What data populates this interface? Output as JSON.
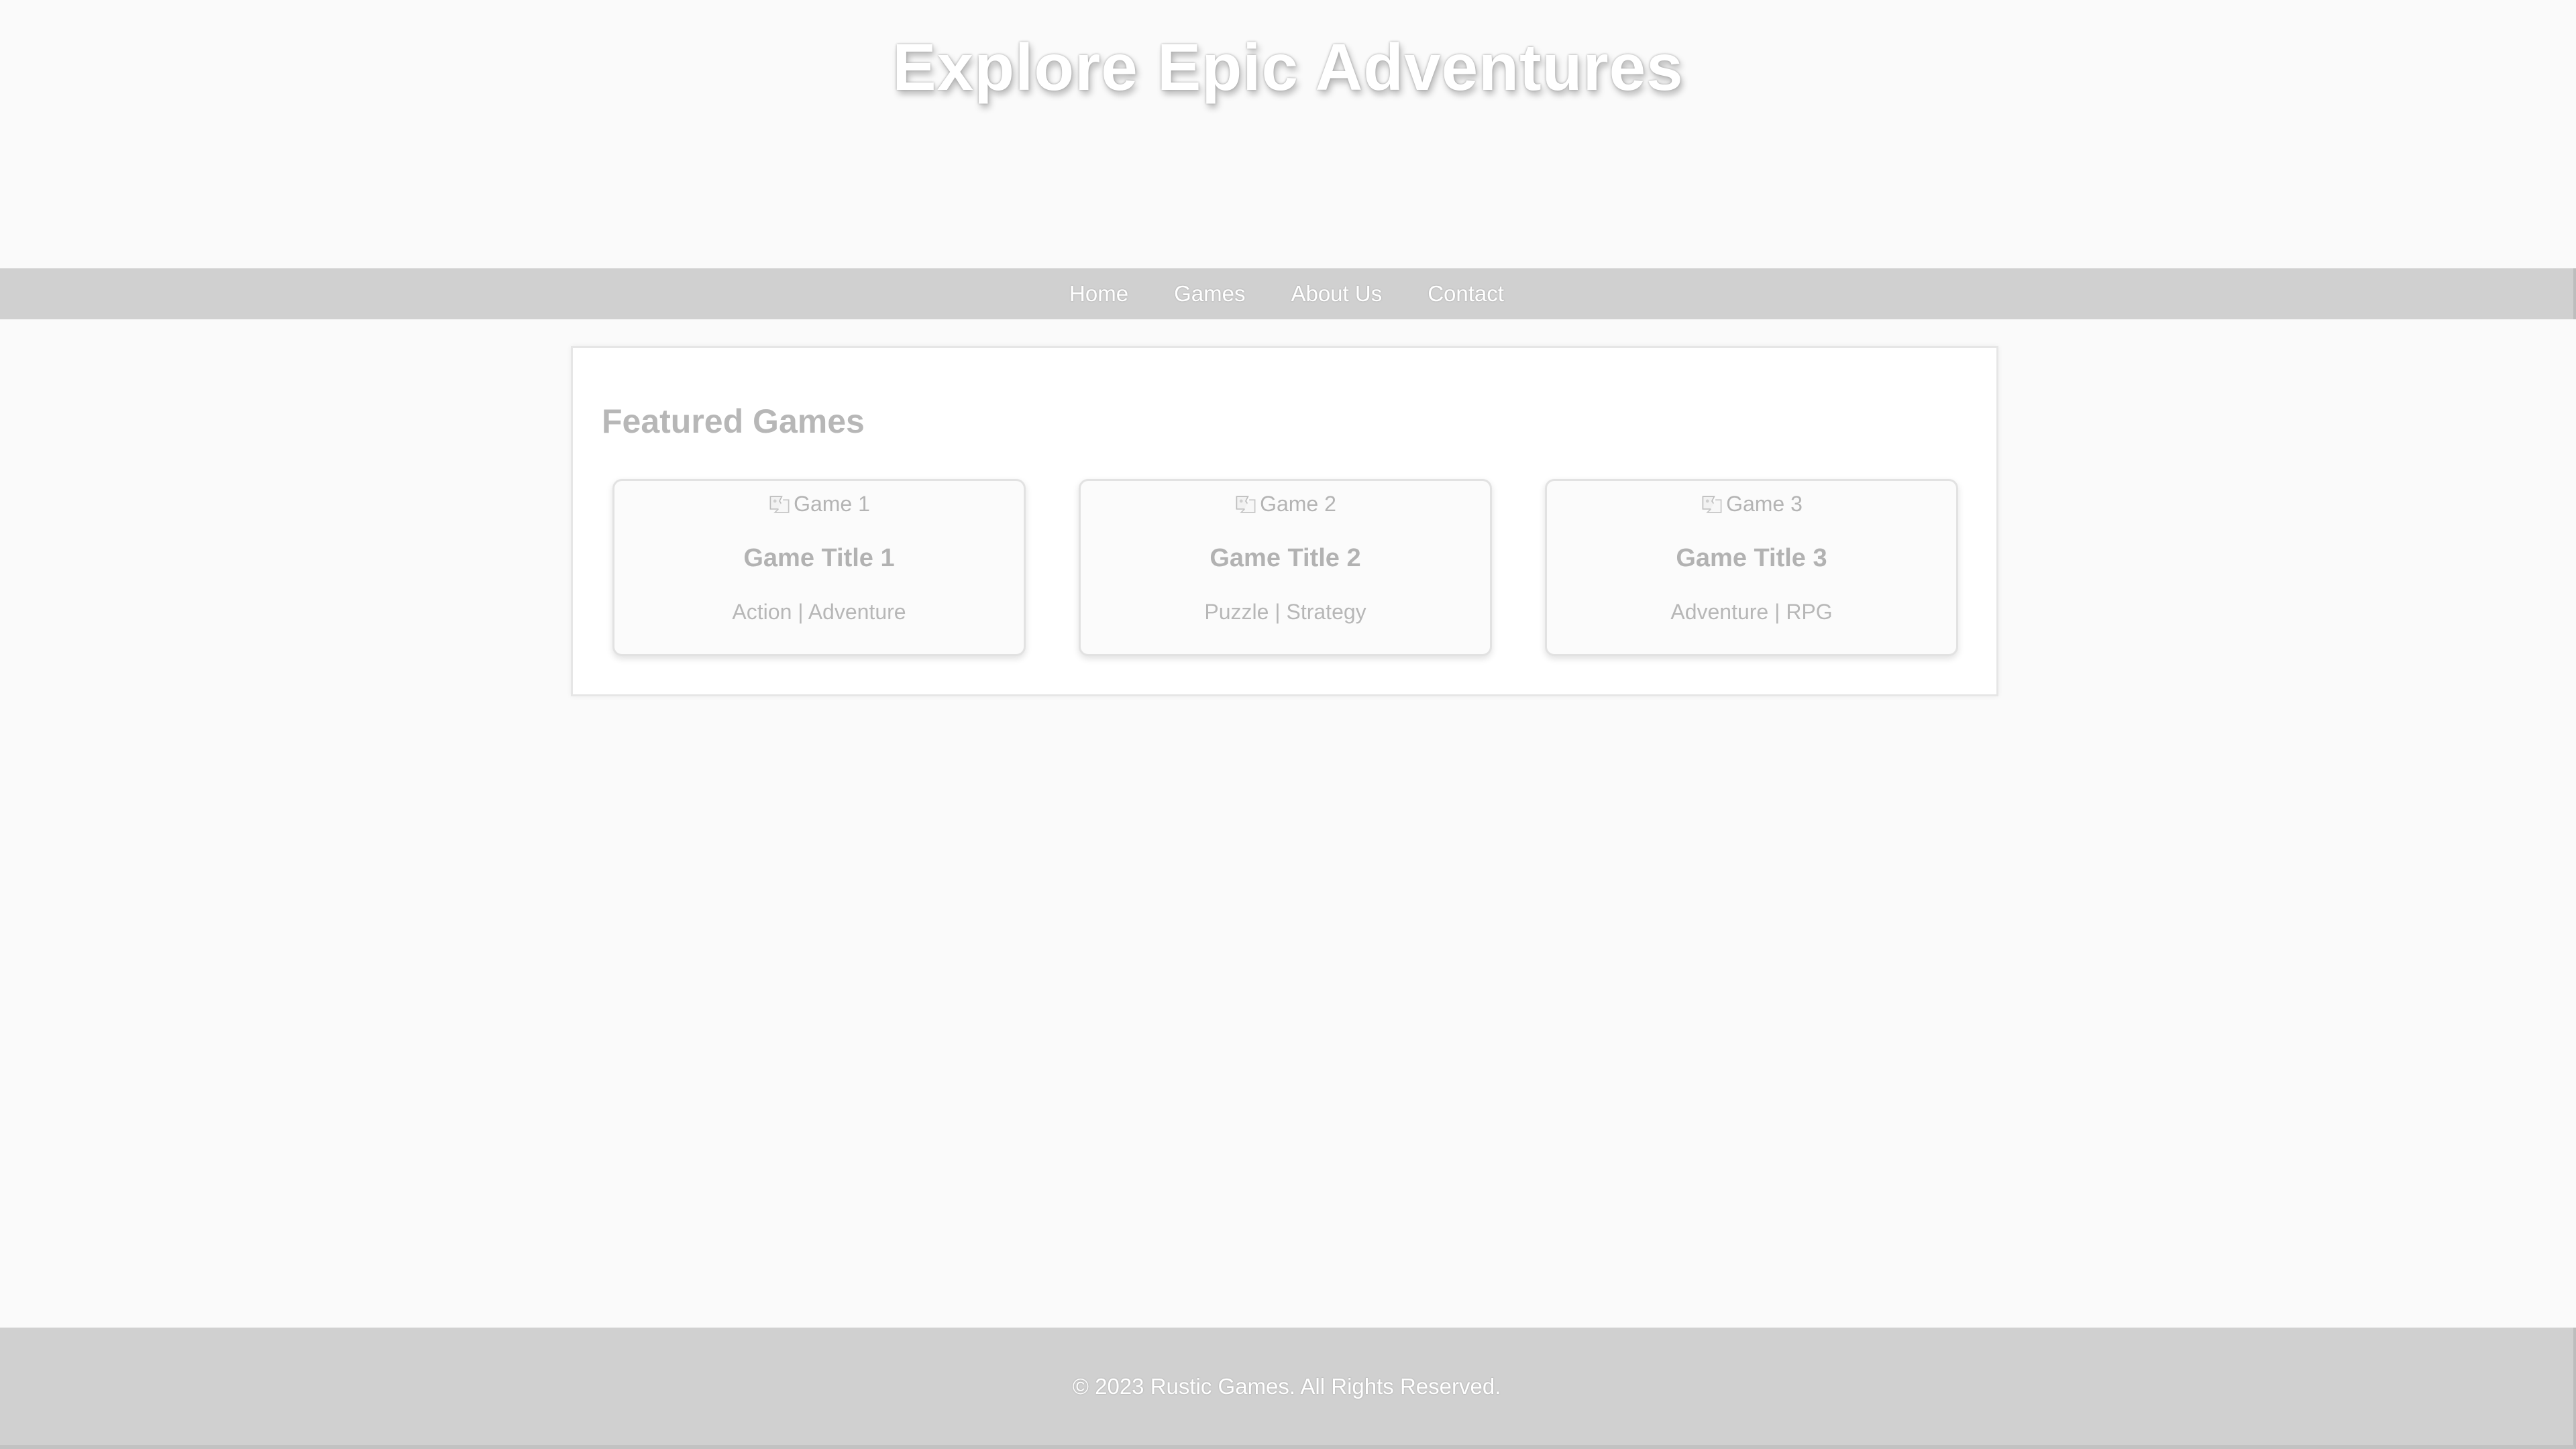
{
  "header": {
    "title": "Explore Epic Adventures"
  },
  "nav": {
    "items": [
      {
        "label": "Home"
      },
      {
        "label": "Games"
      },
      {
        "label": "About Us"
      },
      {
        "label": "Contact"
      }
    ]
  },
  "featured": {
    "heading": "Featured Games",
    "games": [
      {
        "image_alt": "Game 1",
        "title": "Game Title 1",
        "genre": "Action | Adventure"
      },
      {
        "image_alt": "Game 2",
        "title": "Game Title 2",
        "genre": "Puzzle | Strategy"
      },
      {
        "image_alt": "Game 3",
        "title": "Game Title 3",
        "genre": "Adventure | RPG"
      }
    ]
  },
  "footer": {
    "text": "© 2023 Rustic Games. All Rights Reserved."
  },
  "icons": {
    "image_placeholder": "broken-image-icon"
  }
}
